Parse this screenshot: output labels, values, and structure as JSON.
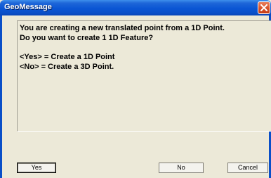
{
  "window": {
    "title": "GeoMessage"
  },
  "message": {
    "lines": [
      "You are creating a new translated point from a 1D Point.",
      "Do you want to create 1 1D Feature?",
      "<Yes> = Create a 1D Point",
      "<No> = Create a 3D Point."
    ]
  },
  "buttons": {
    "yes": "Yes",
    "no": "No",
    "cancel": "Cancel"
  },
  "colors": {
    "titlebar": "#0a55d4",
    "dialog_bg": "#ece9d8",
    "close_button": "#d8532c"
  },
  "icons": {
    "close": "close-icon"
  }
}
